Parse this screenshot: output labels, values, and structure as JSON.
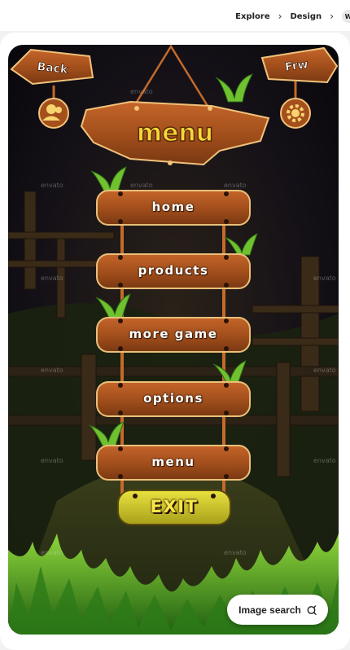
{
  "breadcrumb": {
    "items": [
      "Explore",
      "Design"
    ],
    "avatar_letter": "W"
  },
  "game": {
    "back_label": "Back",
    "frw_label": "Frw",
    "title": "menu",
    "buttons": [
      "Home",
      "Products",
      "More Game",
      "Options",
      "menu"
    ],
    "exit_label": "Exit",
    "watermark": "envato"
  },
  "image_search": {
    "label": "Image search"
  },
  "colors": {
    "wood": "#a8551f",
    "wood_dark": "#6b3210",
    "wood_border": "#e8c07a",
    "exit_yellow": "#d7d12b",
    "title_yellow": "#f7d83a",
    "background": "#0c0a10"
  }
}
